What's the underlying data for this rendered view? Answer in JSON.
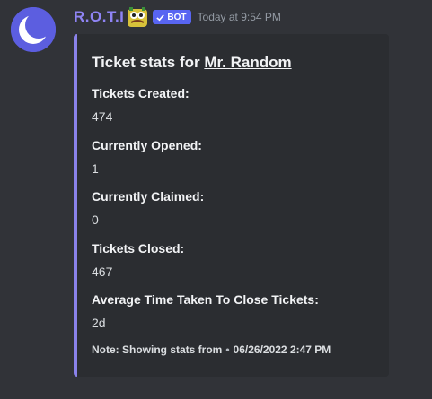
{
  "author": {
    "username": "R.O.T.I",
    "bot_tag": "BOT",
    "timestamp": "Today at 9:54 PM"
  },
  "embed": {
    "title_prefix": "Ticket stats for ",
    "title_link": "Mr. Random",
    "accent_color": "#8a82ea",
    "fields": [
      {
        "name": "Tickets Created:",
        "value": "474"
      },
      {
        "name": "Currently Opened:",
        "value": "1"
      },
      {
        "name": "Currently Claimed:",
        "value": "0"
      },
      {
        "name": "Tickets Closed:",
        "value": "467"
      },
      {
        "name": "Average Time Taken To Close Tickets:",
        "value": "2d"
      }
    ],
    "footer_text": "Note: Showing stats from",
    "footer_separator": "•",
    "footer_date": "06/26/2022 2:47 PM"
  },
  "colors": {
    "background": "#313338",
    "embed_background": "#2b2d31",
    "username": "#8f84f4",
    "bot_tag": "#5865f2"
  },
  "icons": {
    "avatar": "crescent-moon-avatar",
    "decoration": "pepe-emoji-icon",
    "verified": "checkmark-icon"
  }
}
